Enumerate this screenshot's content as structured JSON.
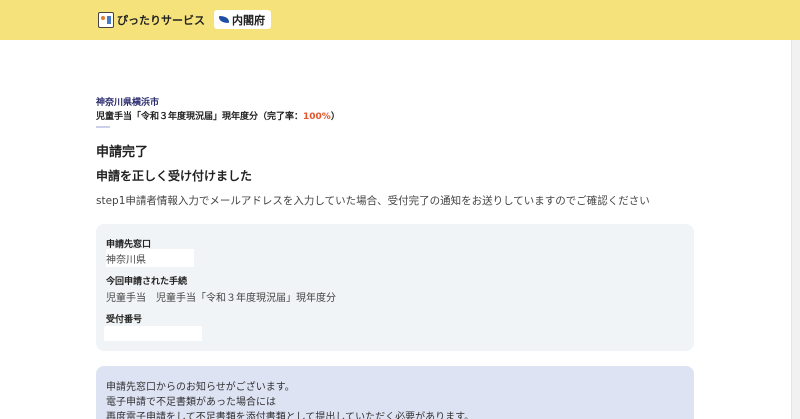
{
  "header": {
    "brand_name": "ぴったりサービス",
    "cabinet_name": "内閣府",
    "brand_color": "#f5e27a"
  },
  "application": {
    "municipality": "神奈川県横浜市",
    "procedure_prefix": "児童手当「令和３年度現況届」現年度分（完了率：",
    "completion_rate": "100%",
    "procedure_suffix": "）"
  },
  "status": {
    "complete_title": "申請完了",
    "accepted_title": "申請を正しく受け付けました",
    "email_notice": "step1申請者情報入力でメールアドレスを入力していた場合、受付完了の通知をお送りしていますのでご確認ください"
  },
  "info": {
    "destination_label": "申請先窓口",
    "destination_value": "神奈川県",
    "procedure_label": "今回申請された手続",
    "procedure_value": "児童手当　児童手当「令和３年度現況届」現年度分",
    "receipt_label": "受付番号"
  },
  "notice": {
    "lines": [
      "申請先窓口からのお知らせがございます。",
      "電子申請で不足書類があった場合には",
      "再度電子申請をして不足書類を添付書類として提出していただく必要があります。"
    ]
  }
}
